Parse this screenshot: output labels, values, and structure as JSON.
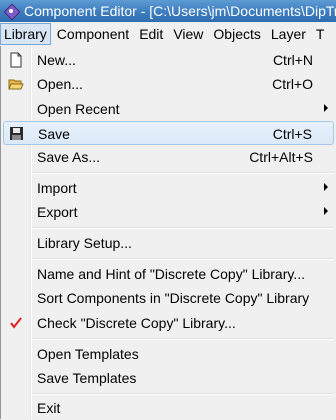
{
  "window": {
    "title": "Component Editor - [C:\\Users\\jm\\Documents\\DipTrace\\Discrete Copy.eli]"
  },
  "menubar": {
    "items": [
      {
        "label": "Library",
        "active": true
      },
      {
        "label": "Component"
      },
      {
        "label": "Edit"
      },
      {
        "label": "View"
      },
      {
        "label": "Objects"
      },
      {
        "label": "Layer"
      },
      {
        "label": "T"
      }
    ]
  },
  "library_menu": {
    "items": [
      {
        "label": "New...",
        "shortcut": "Ctrl+N",
        "icon": "new-file-icon"
      },
      {
        "label": "Open...",
        "shortcut": "Ctrl+O",
        "icon": "open-folder-icon"
      },
      {
        "label": "Open Recent",
        "submenu": true
      },
      {
        "label": "Save",
        "shortcut": "Ctrl+S",
        "icon": "floppy-disk-icon",
        "highlighted": true
      },
      {
        "label": "Save As...",
        "shortcut": "Ctrl+Alt+S"
      },
      {
        "label": "Import",
        "submenu": true
      },
      {
        "label": "Export",
        "submenu": true
      },
      {
        "label": "Library Setup..."
      },
      {
        "label": "Name and Hint of \"Discrete Copy\" Library..."
      },
      {
        "label": "Sort Components in \"Discrete Copy\" Library"
      },
      {
        "label": "Check \"Discrete Copy\" Library...",
        "icon": "checkmark-icon"
      },
      {
        "label": "Open Templates"
      },
      {
        "label": "Save Templates"
      },
      {
        "label": "Exit"
      }
    ]
  },
  "colors": {
    "titlebar": "#3f7fc0",
    "menu_bg": "#f0f0f0",
    "highlight": "#dbe9f8",
    "checkmark": "#e02020"
  }
}
